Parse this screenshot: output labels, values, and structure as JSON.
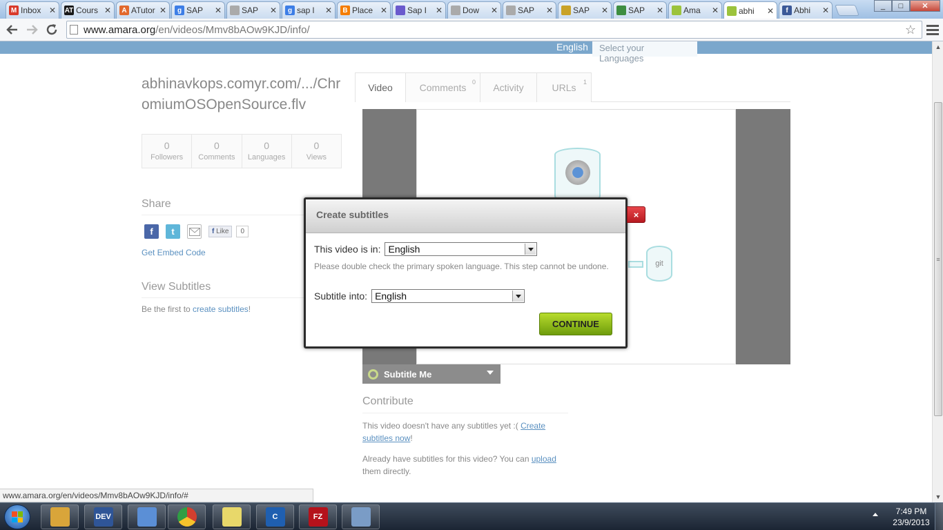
{
  "browser": {
    "tabs": [
      {
        "label": "Inbox",
        "icon": "gmail-icon",
        "color": "#d93a2b",
        "glyph": "M",
        "active": false
      },
      {
        "label": "Cours",
        "icon": "atutor-icon",
        "color": "#1a1a1a",
        "glyph": "AT",
        "active": false
      },
      {
        "label": "ATutor",
        "icon": "atutor-orange-icon",
        "color": "#e2692d",
        "glyph": "A",
        "active": false
      },
      {
        "label": "SAP",
        "icon": "google-icon",
        "color": "#3d7ee6",
        "glyph": "g",
        "active": false
      },
      {
        "label": "SAP",
        "icon": "page-icon",
        "color": "#aaaaaa",
        "glyph": "",
        "active": false
      },
      {
        "label": "sap l",
        "icon": "google-icon",
        "color": "#3d7ee6",
        "glyph": "g",
        "active": false
      },
      {
        "label": "Place",
        "icon": "blogger-icon",
        "color": "#f57d00",
        "glyph": "B",
        "active": false
      },
      {
        "label": "Sap I",
        "icon": "cube-icon",
        "color": "#6a5acd",
        "glyph": "",
        "active": false
      },
      {
        "label": "Dow",
        "icon": "page-icon",
        "color": "#aaaaaa",
        "glyph": "",
        "active": false
      },
      {
        "label": "SAP",
        "icon": "page-icon",
        "color": "#aaaaaa",
        "glyph": "",
        "active": false
      },
      {
        "label": "SAP",
        "icon": "sap-icon",
        "color": "#c9a227",
        "glyph": "",
        "active": false
      },
      {
        "label": "SAP",
        "icon": "leaf-icon",
        "color": "#3e8e41",
        "glyph": "",
        "active": false
      },
      {
        "label": "Ama",
        "icon": "amara-icon",
        "color": "#9cc33c",
        "glyph": "",
        "active": false
      },
      {
        "label": "abhi",
        "icon": "amara-icon",
        "color": "#9cc33c",
        "glyph": "",
        "active": true
      },
      {
        "label": "Abhi",
        "icon": "facebook-icon",
        "color": "#3b5998",
        "glyph": "f",
        "active": false
      }
    ],
    "url_host": "www.amara.org",
    "url_path": "/en/videos/Mmv8bAOw9KJD/info/",
    "status_url": "www.amara.org/en/videos/Mmv8bAOw9KJD/info/#"
  },
  "page": {
    "language_bar": {
      "current": "English",
      "select_placeholder": "Select your Languages"
    },
    "video_title": "abhinavkops.comyr.com/.../ChromiumOSOpenSource.flv",
    "stats": [
      {
        "value": "0",
        "label": "Followers"
      },
      {
        "value": "0",
        "label": "Comments"
      },
      {
        "value": "0",
        "label": "Languages"
      },
      {
        "value": "0",
        "label": "Views"
      }
    ],
    "share": {
      "heading": "Share",
      "like_label": "Like",
      "like_count": "0",
      "embed_link": "Get Embed Code"
    },
    "view_subtitles": {
      "heading": "View Subtitles",
      "prefix": "Be the first to ",
      "link": "create subtitles",
      "suffix": "!"
    },
    "tabs": [
      {
        "label": "Video",
        "count": ""
      },
      {
        "label": "Comments",
        "count": "0"
      },
      {
        "label": "Activity",
        "count": ""
      },
      {
        "label": "URLs",
        "count": "1"
      }
    ],
    "video_graphic_label": "git",
    "subtitle_me": "Subtitle Me",
    "contribute": {
      "heading": "Contribute",
      "text1_prefix": "This video doesn't have any subtitles yet :( ",
      "text1_link": "Create subtitles now",
      "text1_suffix": "!",
      "text2_prefix": "Already have subtitles for this video? You can ",
      "text2_link": "upload",
      "text2_suffix": " them directly."
    }
  },
  "modal": {
    "title": "Create subtitles",
    "close_glyph": "×",
    "video_in_label": "This video is in:",
    "video_in_value": "English",
    "note": "Please double check the primary spoken language. This step cannot be undone.",
    "subtitle_into_label": "Subtitle into:",
    "subtitle_into_value": "English",
    "continue_label": "CONTINUE"
  },
  "taskbar": {
    "items": [
      {
        "name": "explorer",
        "icon": "folder-icon",
        "color": "#d9a53a",
        "text": ""
      },
      {
        "name": "dev",
        "icon": "dev-icon",
        "color": "#2f5597",
        "text": "DEV"
      },
      {
        "name": "cube",
        "icon": "cube-icon",
        "color": "#5b8fd6",
        "text": ""
      },
      {
        "name": "chrome",
        "icon": "chrome-icon",
        "color": "#d33f2f",
        "text": ""
      },
      {
        "name": "notes",
        "icon": "notes-icon",
        "color": "#e8d86a",
        "text": ""
      },
      {
        "name": "ccleaner",
        "icon": "ccleaner-icon",
        "color": "#1f5fb0",
        "text": "C"
      },
      {
        "name": "filezilla",
        "icon": "filezilla-icon",
        "color": "#b5121b",
        "text": "FZ"
      },
      {
        "name": "paint",
        "icon": "paint-icon",
        "color": "#7a9cc6",
        "text": ""
      }
    ],
    "time": "7:49 PM",
    "date": "23/9/2013"
  }
}
